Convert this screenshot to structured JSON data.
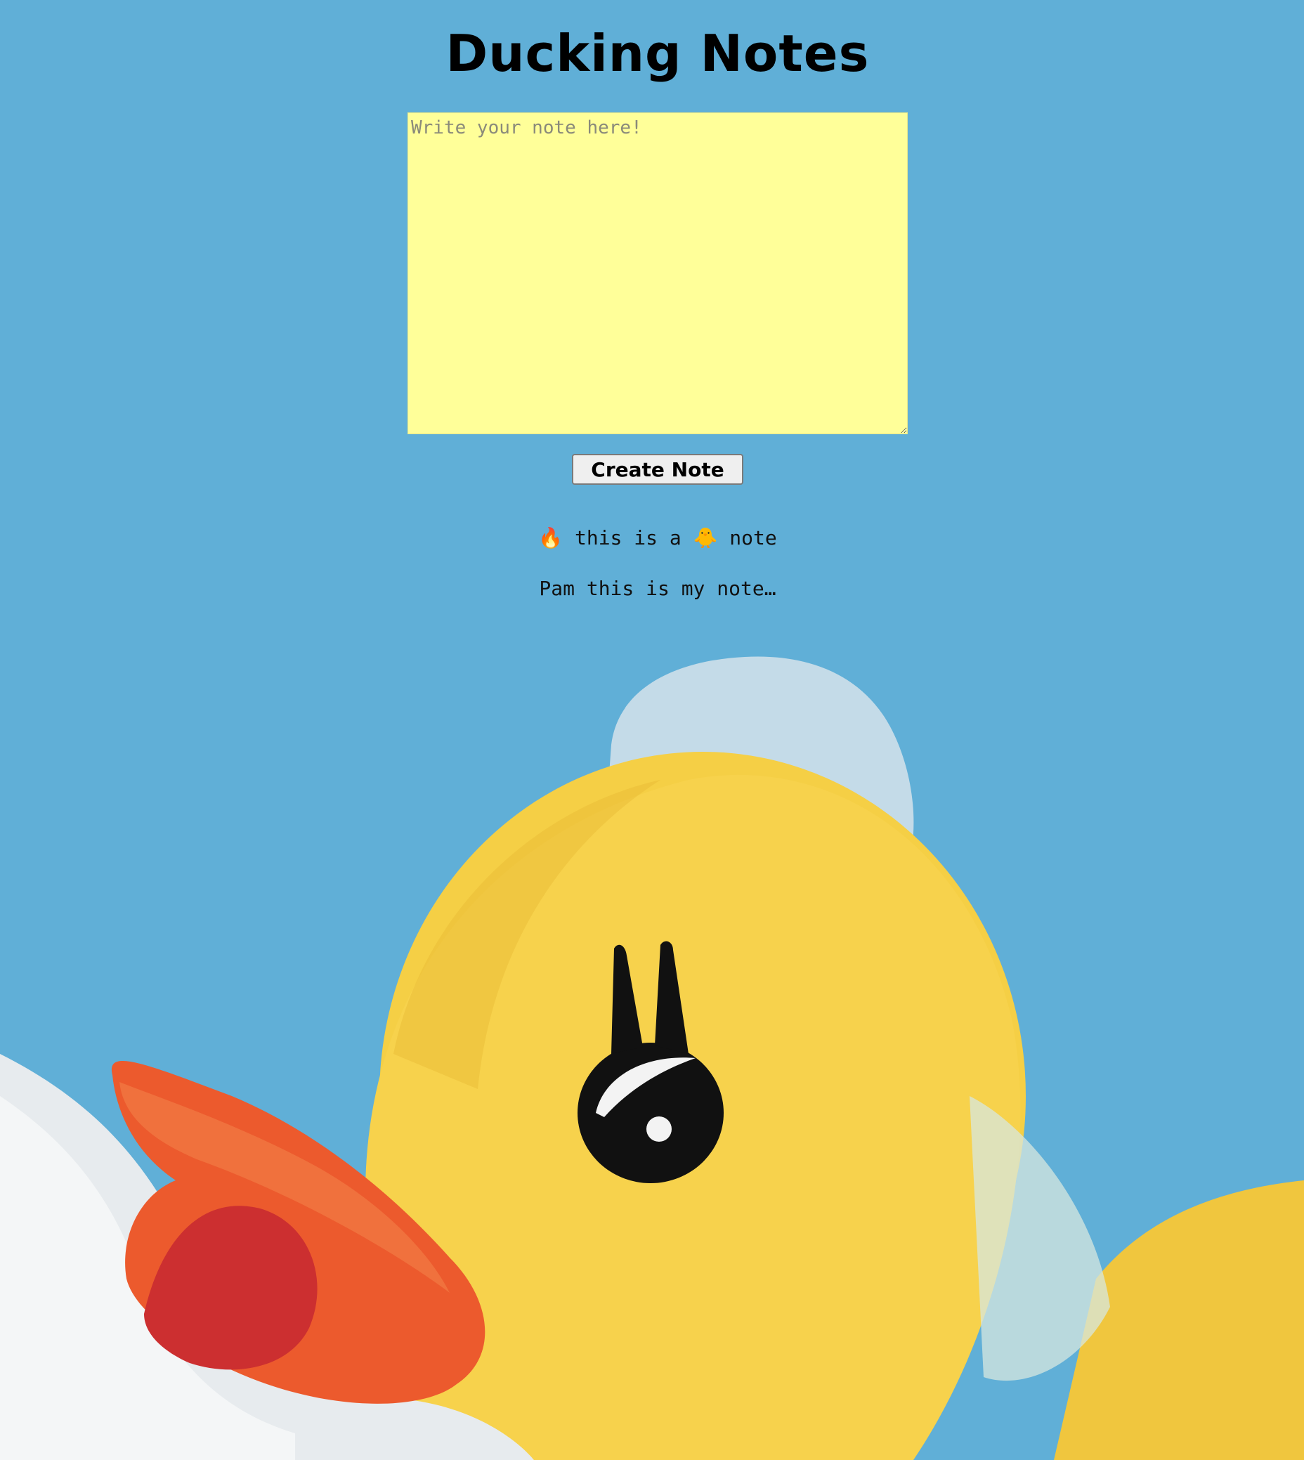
{
  "header": {
    "title": "Ducking Notes"
  },
  "editor": {
    "placeholder": "Write your note here!",
    "value": ""
  },
  "actions": {
    "create_label": "Create Note"
  },
  "notes": [
    {
      "text": "🔥 this is a 🐥 note"
    },
    {
      "text": "Pam this is my note…"
    }
  ],
  "background": {
    "image": "rubber-duck-in-bubbles",
    "sky_color": "#60afd7",
    "duck_color": "#f5cf45",
    "beak_color": "#ef5f2e"
  }
}
